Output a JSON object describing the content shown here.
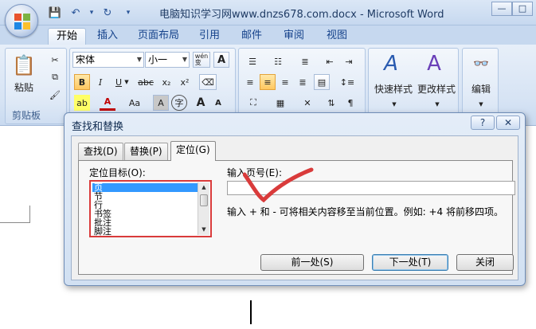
{
  "window": {
    "title": "电脑知识学习网www.dnzs678.com.docx - Microsoft Word"
  },
  "window_controls": {
    "minimize": "—",
    "restore": "□"
  },
  "quick_access": {
    "save_icon": "💾",
    "undo_icon": "↶",
    "undo_menu": "▾",
    "redo_icon": "↻",
    "customize_icon": "▾"
  },
  "ribbon_tabs": [
    {
      "label": "开始"
    },
    {
      "label": "插入"
    },
    {
      "label": "页面布局"
    },
    {
      "label": "引用"
    },
    {
      "label": "邮件"
    },
    {
      "label": "审阅"
    },
    {
      "label": "视图"
    }
  ],
  "clipboard": {
    "paste_label": "粘贴",
    "group_label": "剪贴板",
    "cut_icon": "✂",
    "copy_icon": "⧉",
    "paste_icon": "📋",
    "format_painter_icon": "🖌"
  },
  "font": {
    "name": "宋体",
    "size": "小一",
    "wen_label": "wén\n变",
    "A_label": "A",
    "bold": "B",
    "italic": "I",
    "underline": "U",
    "strike": "abc",
    "sub": "x₂",
    "sup": "x²",
    "highlight": "ab",
    "color": "A",
    "case": "Aa",
    "shade": "A",
    "circle": "字",
    "grow": "A",
    "shrink": "A"
  },
  "paragraph": {
    "bullets_icon": "☰",
    "numbering_icon": "☷",
    "multilevel_icon": "≣"
  },
  "styles": {
    "quick_label": "快速样式",
    "change_label": "更改样式"
  },
  "editing": {
    "label": "编辑",
    "icon": "👓"
  },
  "dialog": {
    "title": "查找和替换",
    "help_icon": "?",
    "close_icon": "✕",
    "tabs": [
      {
        "label": "查找(D)"
      },
      {
        "label": "替换(P)"
      },
      {
        "label": "定位(G)"
      }
    ],
    "target_label": "定位目标(O):",
    "targets": [
      "页",
      "节",
      "行",
      "书签",
      "批注",
      "脚注"
    ],
    "page_input_label": "输入页号(E):",
    "page_input_value": "",
    "hint": "输入 + 和 - 可将相关内容移至当前位置。例如: +4 将前移四项。",
    "prev_button": "前一处(S)",
    "next_button": "下一处(T)",
    "close_button": "关闭"
  },
  "colors": {
    "accent": "#15428b",
    "annotation_red": "#d93b3b",
    "selection": "#3399ff"
  }
}
